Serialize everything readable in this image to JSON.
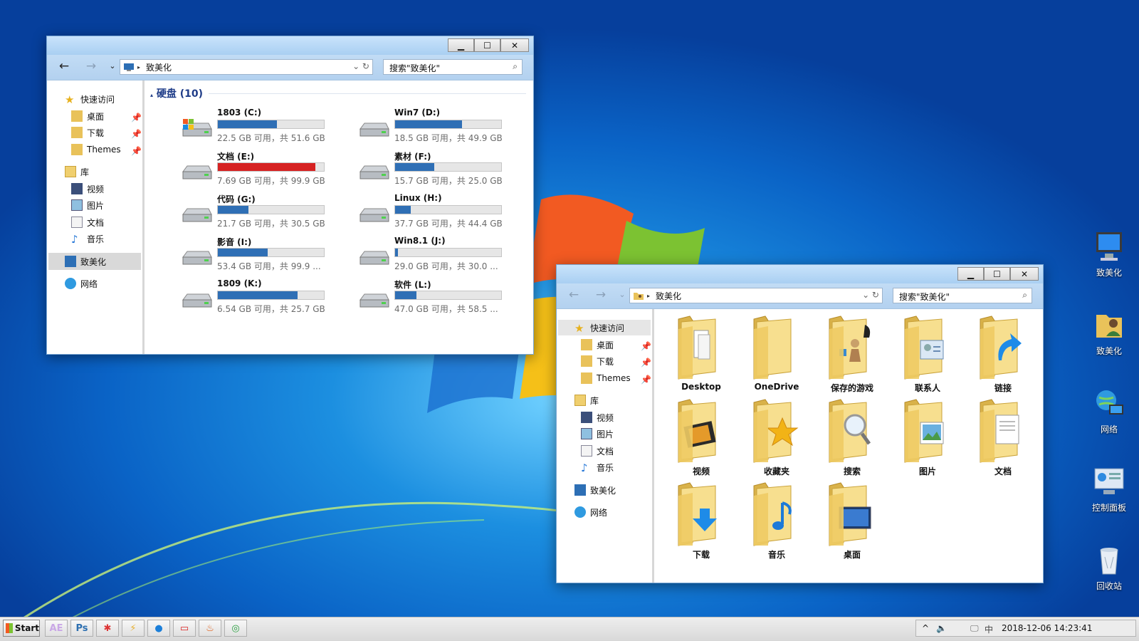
{
  "desktop_icons": [
    {
      "label": "致美化",
      "icon": "computer-icon"
    },
    {
      "label": "致美化",
      "icon": "user-folder-icon"
    },
    {
      "label": "网络",
      "icon": "network-icon"
    },
    {
      "label": "控制面板",
      "icon": "control-panel-icon"
    },
    {
      "label": "回收站",
      "icon": "recycle-bin-icon"
    }
  ],
  "window1": {
    "address": "致美化",
    "search_placeholder": "搜索\"致美化\"",
    "nav": {
      "quick_access": "快速访问",
      "desktop": "桌面",
      "downloads": "下载",
      "themes": "Themes",
      "library": "库",
      "videos": "视频",
      "pictures": "图片",
      "documents": "文档",
      "music": "音乐",
      "this_pc": "致美化",
      "network": "网络"
    },
    "group_title": "硬盘 (10)",
    "drives": [
      {
        "name": "1803 (C:)",
        "info": "22.5 GB 可用，共 51.6 GB",
        "used_fraction": 0.56,
        "icon": "windows-drive-icon"
      },
      {
        "name": "Win7 (D:)",
        "info": "18.5 GB 可用，共 49.9 GB",
        "used_fraction": 0.63,
        "icon": "hard-drive-icon"
      },
      {
        "name": "文档 (E:)",
        "info": "7.69 GB 可用，共 99.9 GB",
        "used_fraction": 0.92,
        "icon": "hard-drive-icon",
        "warning": true
      },
      {
        "name": "素材 (F:)",
        "info": "15.7 GB 可用，共 25.0 GB",
        "used_fraction": 0.37,
        "icon": "hard-drive-icon"
      },
      {
        "name": "代码 (G:)",
        "info": "21.7 GB 可用，共 30.5 GB",
        "used_fraction": 0.29,
        "icon": "hard-drive-icon"
      },
      {
        "name": "Linux (H:)",
        "info": "37.7 GB 可用，共 44.4 GB",
        "used_fraction": 0.15,
        "icon": "hard-drive-icon"
      },
      {
        "name": "影音 (I:)",
        "info": "53.4 GB 可用，共 99.9 ...",
        "used_fraction": 0.47,
        "icon": "hard-drive-icon"
      },
      {
        "name": "Win8.1 (J:)",
        "info": "29.0 GB 可用，共 30.0 ...",
        "used_fraction": 0.03,
        "icon": "hard-drive-icon"
      },
      {
        "name": "1809 (K:)",
        "info": "6.54 GB 可用，共 25.7 GB",
        "used_fraction": 0.75,
        "icon": "hard-drive-icon"
      },
      {
        "name": "软件 (L:)",
        "info": "47.0 GB 可用，共 58.5 ...",
        "used_fraction": 0.2,
        "icon": "hard-drive-icon"
      }
    ]
  },
  "window2": {
    "address": "致美化",
    "search_placeholder": "搜索\"致美化\"",
    "nav": {
      "quick_access": "快速访问",
      "desktop": "桌面",
      "downloads": "下载",
      "themes": "Themes",
      "library": "库",
      "videos": "视频",
      "pictures": "图片",
      "documents": "文档",
      "music": "音乐",
      "this_pc": "致美化",
      "network": "网络"
    },
    "folders": [
      {
        "label": "Desktop",
        "overlay": "pages"
      },
      {
        "label": "OneDrive",
        "overlay": "none"
      },
      {
        "label": "保存的游戏",
        "overlay": "chess"
      },
      {
        "label": "联系人",
        "overlay": "contact"
      },
      {
        "label": "链接",
        "overlay": "arrow"
      },
      {
        "label": "视频",
        "overlay": "film"
      },
      {
        "label": "收藏夹",
        "overlay": "star"
      },
      {
        "label": "搜索",
        "overlay": "magnifier"
      },
      {
        "label": "图片",
        "overlay": "photo"
      },
      {
        "label": "文档",
        "overlay": "doc"
      },
      {
        "label": "下载",
        "overlay": "download"
      },
      {
        "label": "音乐",
        "overlay": "note"
      },
      {
        "label": "桌面",
        "overlay": "screen"
      }
    ]
  },
  "taskbar": {
    "start_label": "Start",
    "apps": [
      {
        "label": "AE",
        "color": "#c9a7e6"
      },
      {
        "label": "Ps",
        "color": "#2d6fb0"
      },
      {
        "label": "✱",
        "color": "#d33"
      },
      {
        "label": "⚡",
        "color": "#e8b030"
      },
      {
        "label": "●",
        "color": "#1b7fd9"
      },
      {
        "label": "▭",
        "color": "#d22"
      },
      {
        "label": "♨",
        "color": "#e05a10"
      },
      {
        "label": "◎",
        "color": "#2aa040"
      }
    ],
    "tray_expand": "^",
    "datetime": "2018-12-06  14:23:41"
  }
}
